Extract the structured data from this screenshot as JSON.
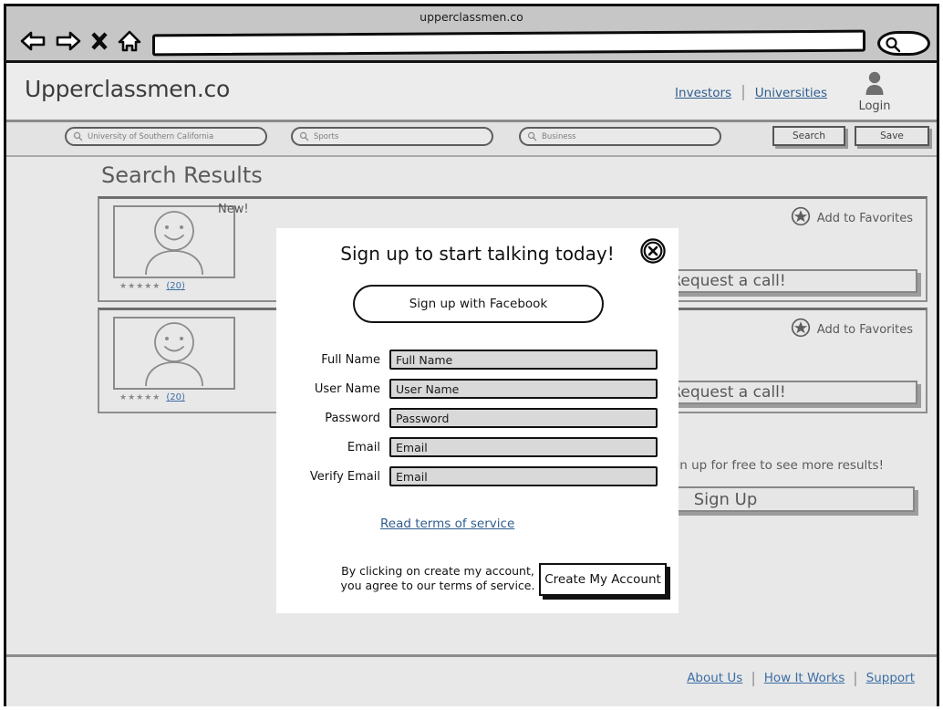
{
  "browser": {
    "title": "upperclassmen.co",
    "url_value": "",
    "controls": [
      {
        "name": "back-icon",
        "label": "Back"
      },
      {
        "name": "forward-icon",
        "label": "Forward"
      },
      {
        "name": "stop-icon",
        "label": "Stop"
      },
      {
        "name": "home-icon",
        "label": "Home"
      }
    ],
    "search_icon": "search-icon"
  },
  "header": {
    "logo": "Upperclassmen.co",
    "links": [
      {
        "label": "Investors"
      },
      {
        "label": "Universities"
      }
    ],
    "separator": "|",
    "login_label": "Login"
  },
  "search_bar": {
    "fields": [
      {
        "name": "search-field-school",
        "value": "University of Southern California"
      },
      {
        "name": "search-field-interest",
        "value": "Sports"
      },
      {
        "name": "search-field-major",
        "value": "Business"
      }
    ],
    "search_button": "Search",
    "save_button": "Save"
  },
  "results": {
    "title": "Search Results",
    "cards": [
      {
        "badge": "New!",
        "stars": "★★★★★",
        "count": "(20)",
        "favorite_label": "Add to Favorites",
        "call_button": "Request a call!"
      },
      {
        "badge": "",
        "stars": "★★★★★",
        "count": "(20)",
        "favorite_label": "Add to Favorites",
        "call_button": "Request a call!"
      }
    ],
    "signup_note": "Sign up for free to see more results!",
    "signup_button": "Sign Up"
  },
  "footer": {
    "links": [
      {
        "label": "About Us"
      },
      {
        "label": "How It Works"
      },
      {
        "label": "Support"
      }
    ],
    "separator": "|"
  },
  "modal": {
    "title": "Sign up to start talking today!",
    "close_icon": "close-circle-icon",
    "facebook_button": "Sign up with Facebook",
    "fields": [
      {
        "label": "Full Name",
        "placeholder": "Full Name"
      },
      {
        "label": "User Name",
        "placeholder": "User Name"
      },
      {
        "label": "Password",
        "placeholder": "Password"
      },
      {
        "label": "Email",
        "placeholder": "Email"
      },
      {
        "label": "Verify Email",
        "placeholder": "Email"
      }
    ],
    "terms_link": "Read terms of service",
    "disclaimer": "By clicking on create my account, you agree to our terms of service.",
    "create_button": "Create My Account"
  },
  "colors": {
    "chrome_bg": "#c6c6c6",
    "page_bg": "#e8e8e8",
    "link": "#3b6ea5",
    "ink": "#111111"
  }
}
